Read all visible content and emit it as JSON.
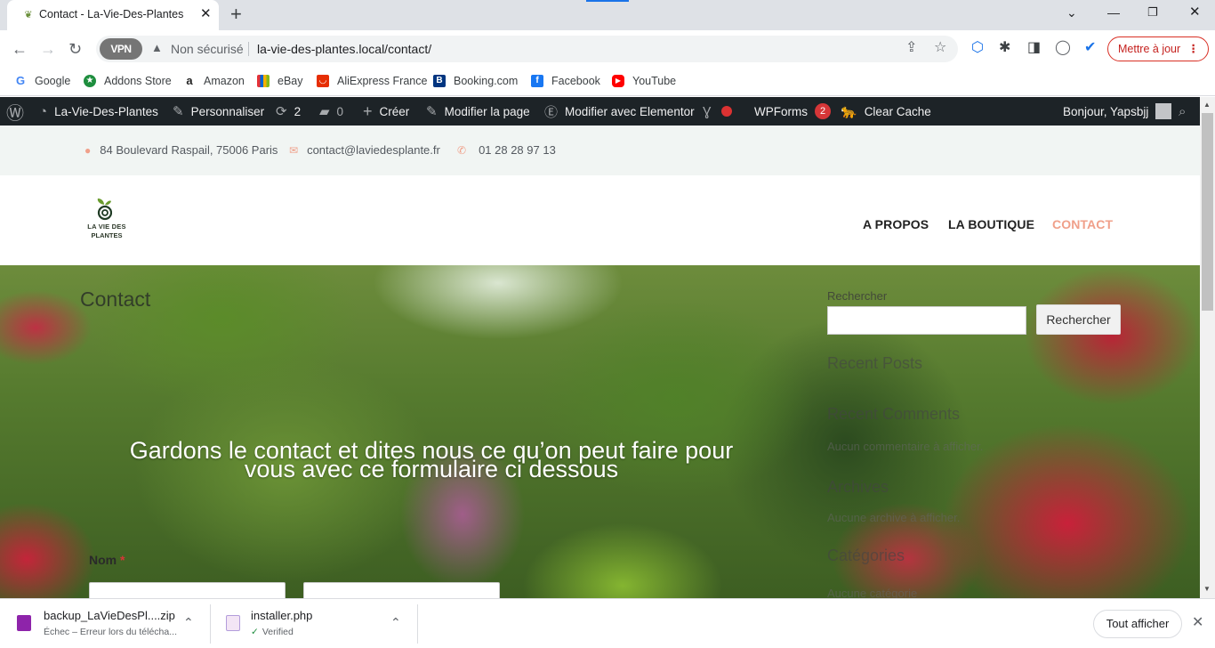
{
  "browser": {
    "tab_title": "Contact - La-Vie-Des-Plantes",
    "vpn_label": "VPN",
    "security_label": "Non sécurisé",
    "url": "la-vie-des-plantes.local/contact/",
    "update_button": "Mettre à jour"
  },
  "bookmarks": [
    {
      "label": "Google",
      "icon": "google-icon",
      "color": "#4285f4"
    },
    {
      "label": "Addons Store",
      "icon": "addons-icon",
      "color": "#1e8e3e"
    },
    {
      "label": "Amazon",
      "icon": "amazon-icon",
      "color": "#222222"
    },
    {
      "label": "eBay",
      "icon": "ebay-icon",
      "color": "#e53238"
    },
    {
      "label": "AliExpress France",
      "icon": "aliexpress-icon",
      "color": "#e62e04"
    },
    {
      "label": "Booking.com",
      "icon": "booking-icon",
      "color": "#003580"
    },
    {
      "label": "Facebook",
      "icon": "facebook-icon",
      "color": "#1877f2"
    },
    {
      "label": "YouTube",
      "icon": "youtube-icon",
      "color": "#ff0000"
    }
  ],
  "admin_bar": {
    "site_name": "La-Vie-Des-Plantes",
    "customize": "Personnaliser",
    "updates_count": "2",
    "comments_count": "0",
    "new": "Créer",
    "edit_page": "Modifier la page",
    "edit_elementor": "Modifier avec Elementor",
    "wpforms": "WPForms",
    "wpforms_count": "2",
    "clear_cache": "Clear Cache",
    "greeting": "Bonjour, Yapsbjj"
  },
  "topinfo": {
    "address": "84 Boulevard Raspail, 75006 Paris",
    "email": "contact@laviedesplante.fr",
    "phone": "01 28 28 97 13"
  },
  "header": {
    "logo_line1": "LA VIE DES",
    "logo_line2": "PLANTES",
    "menu": [
      "A PROPOS",
      "LA BOUTIQUE",
      "CONTACT"
    ],
    "active_color": "#f0a08a"
  },
  "hero": {
    "page_title": "Contact",
    "intro_line1": "Gardons le contact et dites nous ce qu’on peut faire pour",
    "intro_line2": "vous avec ce formulaire ci dessous",
    "name_label": "Nom",
    "required_mark": "*"
  },
  "sidebar": {
    "search_label": "Rechercher",
    "search_button": "Rechercher",
    "recent_posts": "Recent Posts",
    "recent_comments": "Recent Comments",
    "no_comments": "Aucun commentaire à afficher.",
    "archives": "Archives",
    "no_archives": "Aucune archive à afficher.",
    "categories": "Catégories",
    "no_categories": "Aucune catégorie"
  },
  "downloads": [
    {
      "name": "backup_LaVieDesPl....zip",
      "status": "Échec – Erreur lors du téléchа...",
      "icon": "zip-file-icon"
    },
    {
      "name": "installer.php",
      "status": "Verified",
      "icon": "php-file-icon"
    }
  ],
  "download_bar": {
    "show_all": "Tout afficher"
  }
}
